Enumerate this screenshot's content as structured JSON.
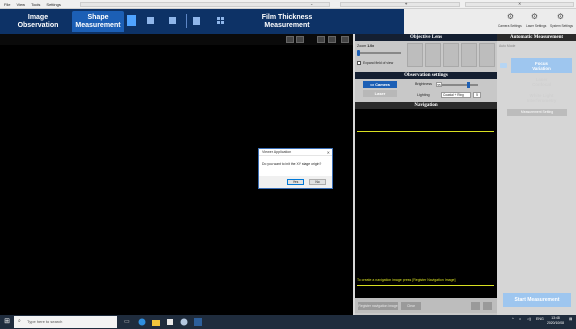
{
  "menu": [
    "File",
    "View",
    "Tools",
    "Settings"
  ],
  "ribbon": {
    "tabs": [
      {
        "line1": "Image",
        "line2": "Observation"
      },
      {
        "line1": "Shape",
        "line2": "Measurement"
      },
      {
        "line1": "Film Thickness",
        "line2": "Measurement"
      }
    ],
    "settings": [
      "Camera Settings",
      "Laser Settings",
      "System Settings"
    ]
  },
  "dialog": {
    "title": "Viewer Application",
    "message": "Do you want to init the XY stage origin?",
    "yes": "Yes",
    "no": "No",
    "close": "✕"
  },
  "objective": {
    "header": "Objective Lens",
    "zoom_label": "Zoom",
    "zoom_value": "1.0x",
    "expand_label": "Expand field of view"
  },
  "observation": {
    "header": "Observation settings",
    "camera": "Camera",
    "laser": "Laser",
    "brightness_label": "Brightness",
    "brightness_value": "55",
    "lighting_label": "Lighting",
    "lighting_value": "Coaxial + Ring",
    "lighting_extra": "5"
  },
  "navigation": {
    "header": "Navigation",
    "hint": "To create a navigation image press [Register Navigation Image]",
    "register_button": "Register navigation image",
    "clear_button": "Clear"
  },
  "automatic": {
    "header": "Automatic Measurement",
    "auto_mode": "Auto Mode",
    "buttons": [
      {
        "line1": "Focus",
        "line2": "Variation",
        "on": true
      },
      {
        "line1": "Laser",
        "line2": "Confocal",
        "on": false
      },
      {
        "line1": "White Light",
        "line2": "Interferometry",
        "on": false
      }
    ],
    "tool_label": "Measurement Setting",
    "start": "Start Measurement"
  },
  "taskbar": {
    "search_placeholder": "Type here to search",
    "lang": "ENG",
    "time": "13:48",
    "date": "2020/10/08"
  }
}
